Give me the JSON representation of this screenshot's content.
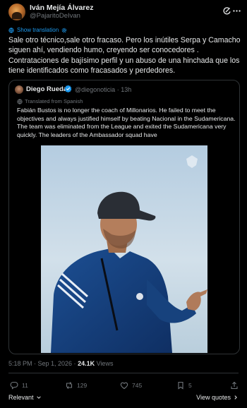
{
  "author": {
    "display_name": "Iván Mejía Álvarez",
    "handle": "@PajaritoDeIvan"
  },
  "translate": {
    "label": "Show translation"
  },
  "post": {
    "text": "Sale otro  técnico,sale otro fracaso. Pero los inútiles Serpa y Camacho siguen ahí, vendiendo humo, creyendo ser conocedores .\nContrataciones de bajísimo perfil y un abuso de una hinchada que los tiene identificados como fracasados y perdedores."
  },
  "quote": {
    "name": "Diego Rueda",
    "handle": "@diegonoticia",
    "separator": "·",
    "time": "13h",
    "translated_label": "Translated from Spanish",
    "text": "Fabián Bustos is no longer the coach of Millonarios. He failed to meet the objectives and always justified himself by beating Nacional in the Sudamericana. The team was eliminated from the League and exited the Sudamericana very quickly. The leaders of the Ambassador squad have"
  },
  "meta": {
    "time": "5:18 PM · Sep 1, 2026 · ",
    "views_count": "24.1K",
    "views_label": " Views"
  },
  "actions": {
    "replies": "11",
    "reposts": "129",
    "likes": "745",
    "bookmarks": "5"
  },
  "footer": {
    "sort_label": "Relevant",
    "view_quotes": "View quotes"
  },
  "icons": {
    "grok": "grok-icon",
    "more": "more-icon",
    "verified": "verified-badge-icon",
    "reply": "reply-icon",
    "repost": "repost-icon",
    "like": "like-icon",
    "bookmark": "bookmark-icon",
    "share": "share-icon"
  },
  "colors": {
    "background": "#000000",
    "text": "#e7e9ea",
    "muted": "#71767b",
    "accent": "#1d9bf0",
    "border": "#2f3336"
  }
}
